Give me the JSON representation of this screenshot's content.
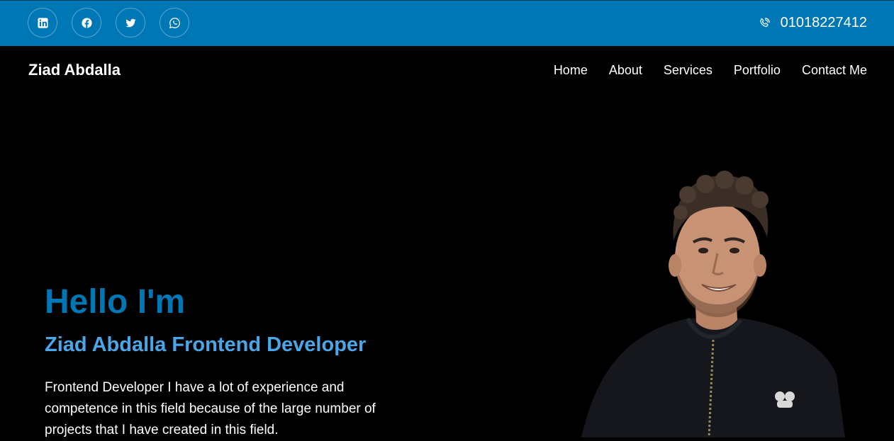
{
  "topbar": {
    "background": "#0077b5",
    "social": [
      {
        "name": "linkedin",
        "icon": "linkedin-icon"
      },
      {
        "name": "facebook",
        "icon": "facebook-icon"
      },
      {
        "name": "twitter",
        "icon": "twitter-icon"
      },
      {
        "name": "whatsapp",
        "icon": "whatsapp-icon"
      }
    ],
    "phone": "01018227412",
    "phone_icon": "phone-icon"
  },
  "nav": {
    "brand": "Ziad Abdalla",
    "items": [
      "Home",
      "About",
      "Services",
      "Portfolio",
      "Contact Me"
    ]
  },
  "hero": {
    "title": "Hello I'm",
    "subtitle": "Ziad Abdalla Frontend Developer",
    "description": "Frontend Developer I have a lot of experience and competence in this field because of the large number of projects that I have created in this field.",
    "title_color": "#0077b5",
    "subtitle_color": "#4aa6e6"
  }
}
